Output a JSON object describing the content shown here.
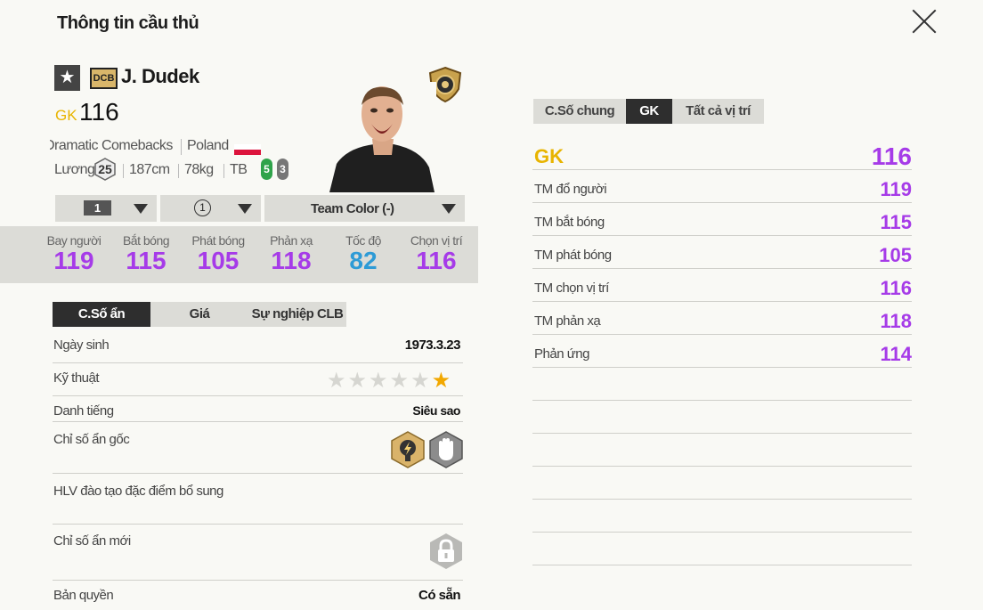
{
  "header": {
    "title": "Thông tin cầu thủ"
  },
  "player": {
    "season_badge": "DCB",
    "name": "J. Dudek",
    "position": "GK",
    "ovr": "116",
    "season_name": "Dramatic Comebacks",
    "nation": "Poland",
    "salary_label": "Lương",
    "salary": "25",
    "height": "187cm",
    "weight": "78kg",
    "body_type": "TB",
    "weak_foot_left": "5",
    "weak_foot_right": "3"
  },
  "dropdowns": {
    "level": "1",
    "team_color_count": "1",
    "team_color": "Team Color (-)"
  },
  "main_stats": [
    {
      "label": "Bay người",
      "value": "119",
      "color": "#a63be8"
    },
    {
      "label": "Bắt bóng",
      "value": "115",
      "color": "#a63be8"
    },
    {
      "label": "Phát bóng",
      "value": "105",
      "color": "#a63be8"
    },
    {
      "label": "Phản xạ",
      "value": "118",
      "color": "#a63be8"
    },
    {
      "label": "Tốc độ",
      "value": "82",
      "color": "#2e9bd6"
    },
    {
      "label": "Chọn vị trí",
      "value": "116",
      "color": "#a63be8"
    }
  ],
  "left_tabs": [
    "C.Số ẩn",
    "Giá",
    "Sự nghiệp CLB"
  ],
  "info": {
    "birth_label": "Ngày sinh",
    "birth_value": "1973.3.23",
    "skill_label": "Kỹ thuật",
    "skill_stars": 1,
    "reputation_label": "Danh tiếng",
    "reputation_value": "Siêu sao",
    "traits_label": "Chỉ số ẩn gốc",
    "coach_label": "HLV đào tạo đặc điểm bổ sung",
    "new_traits_label": "Chỉ số ẩn mới",
    "license_label": "Bản quyền",
    "license_value": "Có sẵn"
  },
  "right_tabs": [
    "C.Số chung",
    "GK",
    "Tất cả vị trí"
  ],
  "right_stats": {
    "position": "GK",
    "position_value": "116",
    "rows": [
      {
        "label": "TM đổ người",
        "value": "119"
      },
      {
        "label": "TM bắt bóng",
        "value": "115"
      },
      {
        "label": "TM phát bóng",
        "value": "105"
      },
      {
        "label": "TM chọn vị trí",
        "value": "116"
      },
      {
        "label": "TM phản xạ",
        "value": "118"
      },
      {
        "label": "Phản ứng",
        "value": "114"
      }
    ]
  },
  "colors": {
    "accent_purple": "#a63be8",
    "accent_gold": "#e8b400",
    "accent_blue": "#2e9bd6"
  }
}
